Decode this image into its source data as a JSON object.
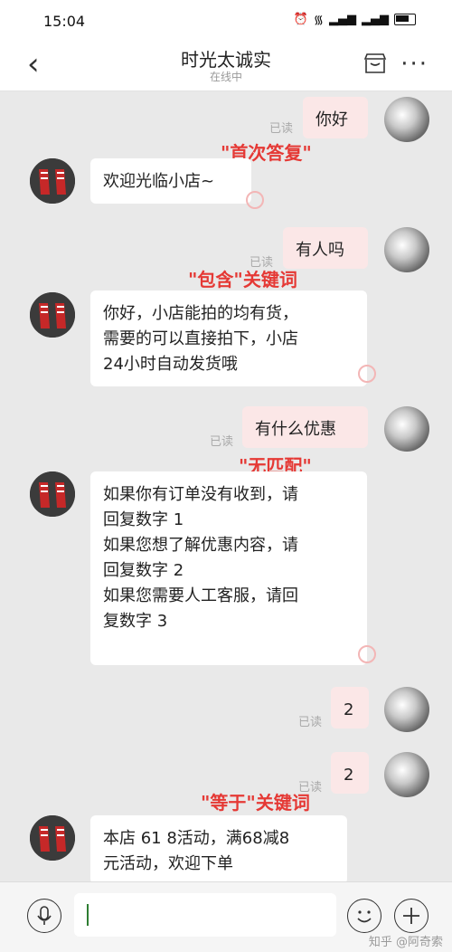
{
  "status": {
    "time": "15:04",
    "icons": [
      "alarm-icon",
      "wifi-icon",
      "signal-icon",
      "signal-icon",
      "battery-icon"
    ]
  },
  "header": {
    "title": "时光太诚实",
    "subtitle": "在线中",
    "back_icon": "chevron-left-icon",
    "shop_icon": "shop-icon",
    "more_icon": "more-icon"
  },
  "chat": {
    "messages": [
      {
        "text": "你好",
        "read": "已读"
      },
      {
        "text": "欢迎光临小店~"
      },
      {
        "text": "有人吗",
        "read": "已读"
      },
      {
        "text": "你好，小店能拍的均有货，\n需要的可以直接拍下，小店\n24小时自动发货哦"
      },
      {
        "text": "有什么优惠",
        "read": "已读"
      },
      {
        "text": "如果你有订单没有收到，请\n回复数字 1\n如果您想了解优惠内容，请\n回复数字 2\n如果您需要人工客服，请回\n复数字 3"
      },
      {
        "text": "2",
        "read": "已读"
      },
      {
        "text": "2",
        "read": "已读"
      },
      {
        "text": "本店 61 8活动，满68减8\n元活动，欢迎下单"
      }
    ],
    "annotations": [
      "\"首次答复\"",
      "\"包含\"关键词",
      "\"无匹配\"",
      "\"等于\"关键词"
    ]
  },
  "input": {
    "placeholder": ""
  },
  "watermark": "知乎 @阿奇索",
  "colors": {
    "accent_red": "#e53935",
    "outgoing_bubble": "#fbe7e7",
    "background": "#e9e9e9"
  }
}
